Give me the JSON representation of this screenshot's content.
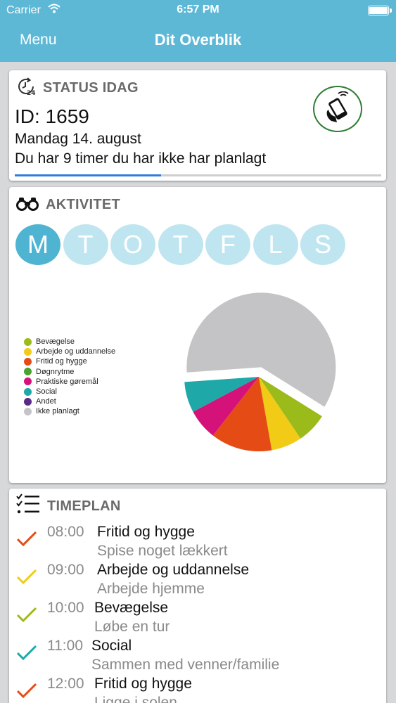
{
  "statusbar": {
    "carrier": "Carrier",
    "time": "6:57 PM"
  },
  "navbar": {
    "menu_label": "Menu",
    "title": "Dit Overblik"
  },
  "status_card": {
    "heading": "STATUS IDAG",
    "id_text": "ID: 1659",
    "date": "Mandag 14. august",
    "message": "Du har 9 timer du har ikke har planlagt",
    "progress_fraction": 0.4
  },
  "activity_card": {
    "heading": "AKTIVITET",
    "days": [
      {
        "label": "M",
        "active": true
      },
      {
        "label": "T",
        "active": false
      },
      {
        "label": "O",
        "active": false
      },
      {
        "label": "T",
        "active": false
      },
      {
        "label": "F",
        "active": false
      },
      {
        "label": "L",
        "active": false
      },
      {
        "label": "S",
        "active": false
      }
    ],
    "legend": [
      {
        "label": "Bevægelse",
        "color": "#9bbb1b"
      },
      {
        "label": "Arbejde og uddannelse",
        "color": "#f1cb16"
      },
      {
        "label": "Fritid og hygge",
        "color": "#e54c15"
      },
      {
        "label": "Døgnrytme",
        "color": "#4aa22f"
      },
      {
        "label": "Praktiske gøremål",
        "color": "#d5127a"
      },
      {
        "label": "Social",
        "color": "#1fa8a8"
      },
      {
        "label": "Andet",
        "color": "#5b2a86"
      },
      {
        "label": "Ikke planlagt",
        "color": "#c4c4c6"
      }
    ]
  },
  "chart_data": {
    "type": "pie",
    "slices": [
      {
        "label": "Ikke planlagt",
        "value": 9,
        "color": "#c4c4c6",
        "exploded": true
      },
      {
        "label": "Bevægelse",
        "value": 1,
        "color": "#9bbb1b"
      },
      {
        "label": "Arbejde og uddannelse",
        "value": 1,
        "color": "#f1cb16"
      },
      {
        "label": "Fritid og hygge",
        "value": 2,
        "color": "#e54c15"
      },
      {
        "label": "Praktiske gøremål",
        "value": 1,
        "color": "#d5127a"
      },
      {
        "label": "Social",
        "value": 1,
        "color": "#1fa8a8"
      }
    ]
  },
  "timeplan_card": {
    "heading": "TIMEPLAN",
    "entries": [
      {
        "time": "08:00",
        "category": "Fritid og hygge",
        "description": "Spise noget lækkert",
        "color": "#e54c15"
      },
      {
        "time": "09:00",
        "category": "Arbejde og uddannelse",
        "description": "Arbejde hjemme",
        "color": "#f1cb16"
      },
      {
        "time": "10:00",
        "category": "Bevægelse",
        "description": "Løbe en tur",
        "color": "#9bbb1b"
      },
      {
        "time": "11:00",
        "category": "Social",
        "description": "Sammen med venner/familie",
        "color": "#1fa8a8"
      },
      {
        "time": "12:00",
        "category": "Fritid og hygge",
        "description": "Ligge i solen",
        "color": "#e54c15"
      }
    ]
  }
}
